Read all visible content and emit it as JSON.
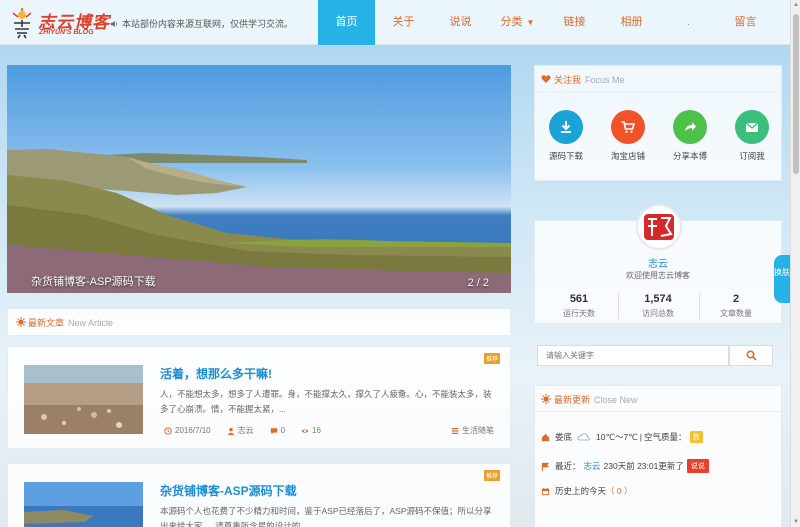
{
  "header": {
    "logo_cn": "志云博客",
    "logo_en": "ZHIYUN'S BLOG",
    "notice": "本站部份内容来源互联网，仅供学习交流。",
    "nav": [
      {
        "label": "首页",
        "active": true
      },
      {
        "label": "关于"
      },
      {
        "label": "说说"
      },
      {
        "label": "分类",
        "dropdown": true
      },
      {
        "label": "链接"
      },
      {
        "label": "相册"
      },
      {
        "label": "."
      },
      {
        "label": "留言"
      }
    ]
  },
  "slider": {
    "caption": "杂货铺博客-ASP源码下载",
    "pager": "2 / 2"
  },
  "latest": {
    "title": "最新文章",
    "subtitle": "New Article"
  },
  "articles": [
    {
      "title": "活着，想那么多干嘛!",
      "tag": "推荐",
      "excerpt": "人，不能想太多，想多了人遭罪。身，不能撑太久，撑久了人疲惫。心，不能装太多，装多了心崩溃。情，不能握太紧，...",
      "date": "2016/7/10",
      "author": "志云",
      "comments": "0",
      "views": "16",
      "category": "生活随笔"
    },
    {
      "title": "杂货铺博客-ASP源码下载",
      "tag": "推荐",
      "excerpt": "本源码个人也花费了不少精力和时间，鉴于ASP已经落后了，ASP源码不保值；所以分享出来给大家，，请尊重所含星的设计的"
    }
  ],
  "follow": {
    "title": "关注我",
    "subtitle": "Focus Me",
    "items": [
      {
        "label": "源码下载",
        "color": "#1ba3d8"
      },
      {
        "label": "淘宝店铺",
        "color": "#f0522a"
      },
      {
        "label": "分享本博",
        "color": "#4cc24a"
      },
      {
        "label": "订阅我",
        "color": "#3bbf7a"
      }
    ]
  },
  "profile": {
    "name": "志云",
    "welcome": "欢迎使用志云博客",
    "stats": [
      {
        "num": "561",
        "label": "运行天数"
      },
      {
        "num": "1,574",
        "label": "访问总数"
      },
      {
        "num": "2",
        "label": "文章数量"
      }
    ]
  },
  "search": {
    "placeholder": "请输入关键字"
  },
  "recent": {
    "title": "最新更新",
    "subtitle": "Close New",
    "weather_city": "娄底",
    "weather_temp": "10℃～7℃",
    "weather_air": "空气质量：",
    "weather_badge": "良",
    "update_prefix": "最近：",
    "update_user": "志云",
    "update_text": "230天前 23:01更新了",
    "update_badge": "说说",
    "history_label": "历史上的今天",
    "history_count": "（ 0 ）"
  },
  "side_tab": "换肤"
}
